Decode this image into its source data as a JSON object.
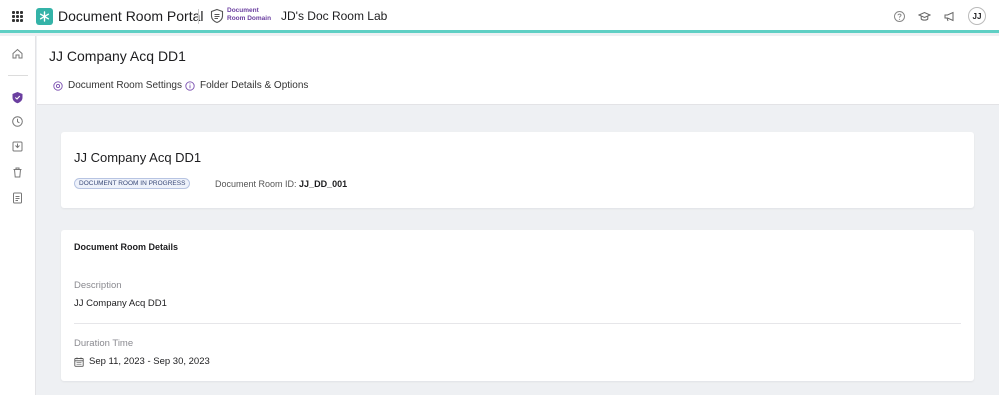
{
  "topbar": {
    "app_title": "Document Room Portal",
    "domain_line1": "Document",
    "domain_line2": "Room Domain",
    "lab_title": "JD's Doc Room Lab",
    "avatar_initials": "JJ",
    "accent_color": "#5fcfc4",
    "logo_color": "#34b3a8",
    "icons": [
      "apps-grid-icon",
      "help-icon",
      "graduation-cap-icon",
      "megaphone-icon"
    ]
  },
  "sidebar": {
    "items": [
      {
        "icon": "home-icon"
      },
      {
        "icon": "shield-icon",
        "active": true
      },
      {
        "icon": "clock-icon"
      },
      {
        "icon": "inbox-download-icon"
      },
      {
        "icon": "trash-icon"
      },
      {
        "icon": "clipboard-icon"
      }
    ]
  },
  "header": {
    "page_title": "JJ Company Acq DD1",
    "tabs": [
      {
        "label": "Document Room Settings",
        "icon": "settings-icon"
      },
      {
        "label": "Folder Details & Options",
        "icon": "info-icon"
      }
    ]
  },
  "summary_card": {
    "title": "JJ Company Acq DD1",
    "status_badge": "DOCUMENT ROOM IN PROGRESS",
    "room_id_label": "Document Room ID:",
    "room_id_value": "JJ_DD_001"
  },
  "details_card": {
    "section_title": "Document Room Details",
    "description_label": "Description",
    "description_value": "JJ Company Acq DD1",
    "duration_label": "Duration Time",
    "duration_value": "Sep 11, 2023 - Sep 30, 2023"
  }
}
